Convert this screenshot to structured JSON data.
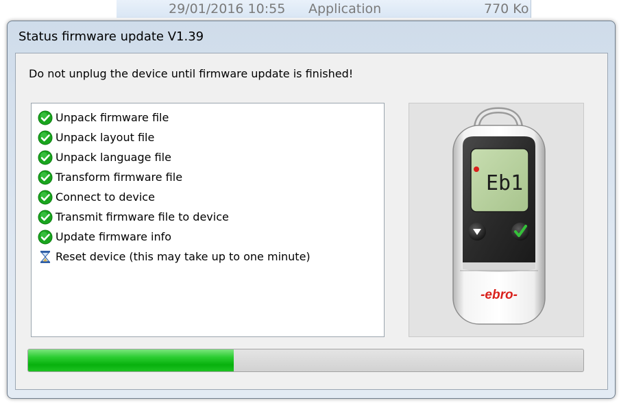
{
  "background_row": {
    "date": "29/01/2016 10:55",
    "type": "Application",
    "size": "770 Ko"
  },
  "dialog": {
    "title": "Status firmware update V1.39",
    "warning": "Do not unplug the device until firmware update is finished!"
  },
  "steps": [
    {
      "label": "Unpack firmware file",
      "status": "done",
      "icon": "checkmark-icon"
    },
    {
      "label": "Unpack layout file",
      "status": "done",
      "icon": "checkmark-icon"
    },
    {
      "label": "Unpack language file",
      "status": "done",
      "icon": "checkmark-icon"
    },
    {
      "label": "Transform firmware file",
      "status": "done",
      "icon": "checkmark-icon"
    },
    {
      "label": "Connect to device",
      "status": "done",
      "icon": "checkmark-icon"
    },
    {
      "label": "Transmit firmware file to device",
      "status": "done",
      "icon": "checkmark-icon"
    },
    {
      "label": "Update firmware info",
      "status": "done",
      "icon": "checkmark-icon"
    },
    {
      "label": "Reset device (this may take up to one minute)",
      "status": "in-progress",
      "icon": "hourglass-icon"
    }
  ],
  "device": {
    "display_text": "Eb1",
    "brand": "-ebro-"
  },
  "progress": {
    "fraction": 0.37
  },
  "colors": {
    "check_green": "#1aa51f",
    "progress_green": "#13bd18",
    "brand_red": "#d9211c"
  }
}
